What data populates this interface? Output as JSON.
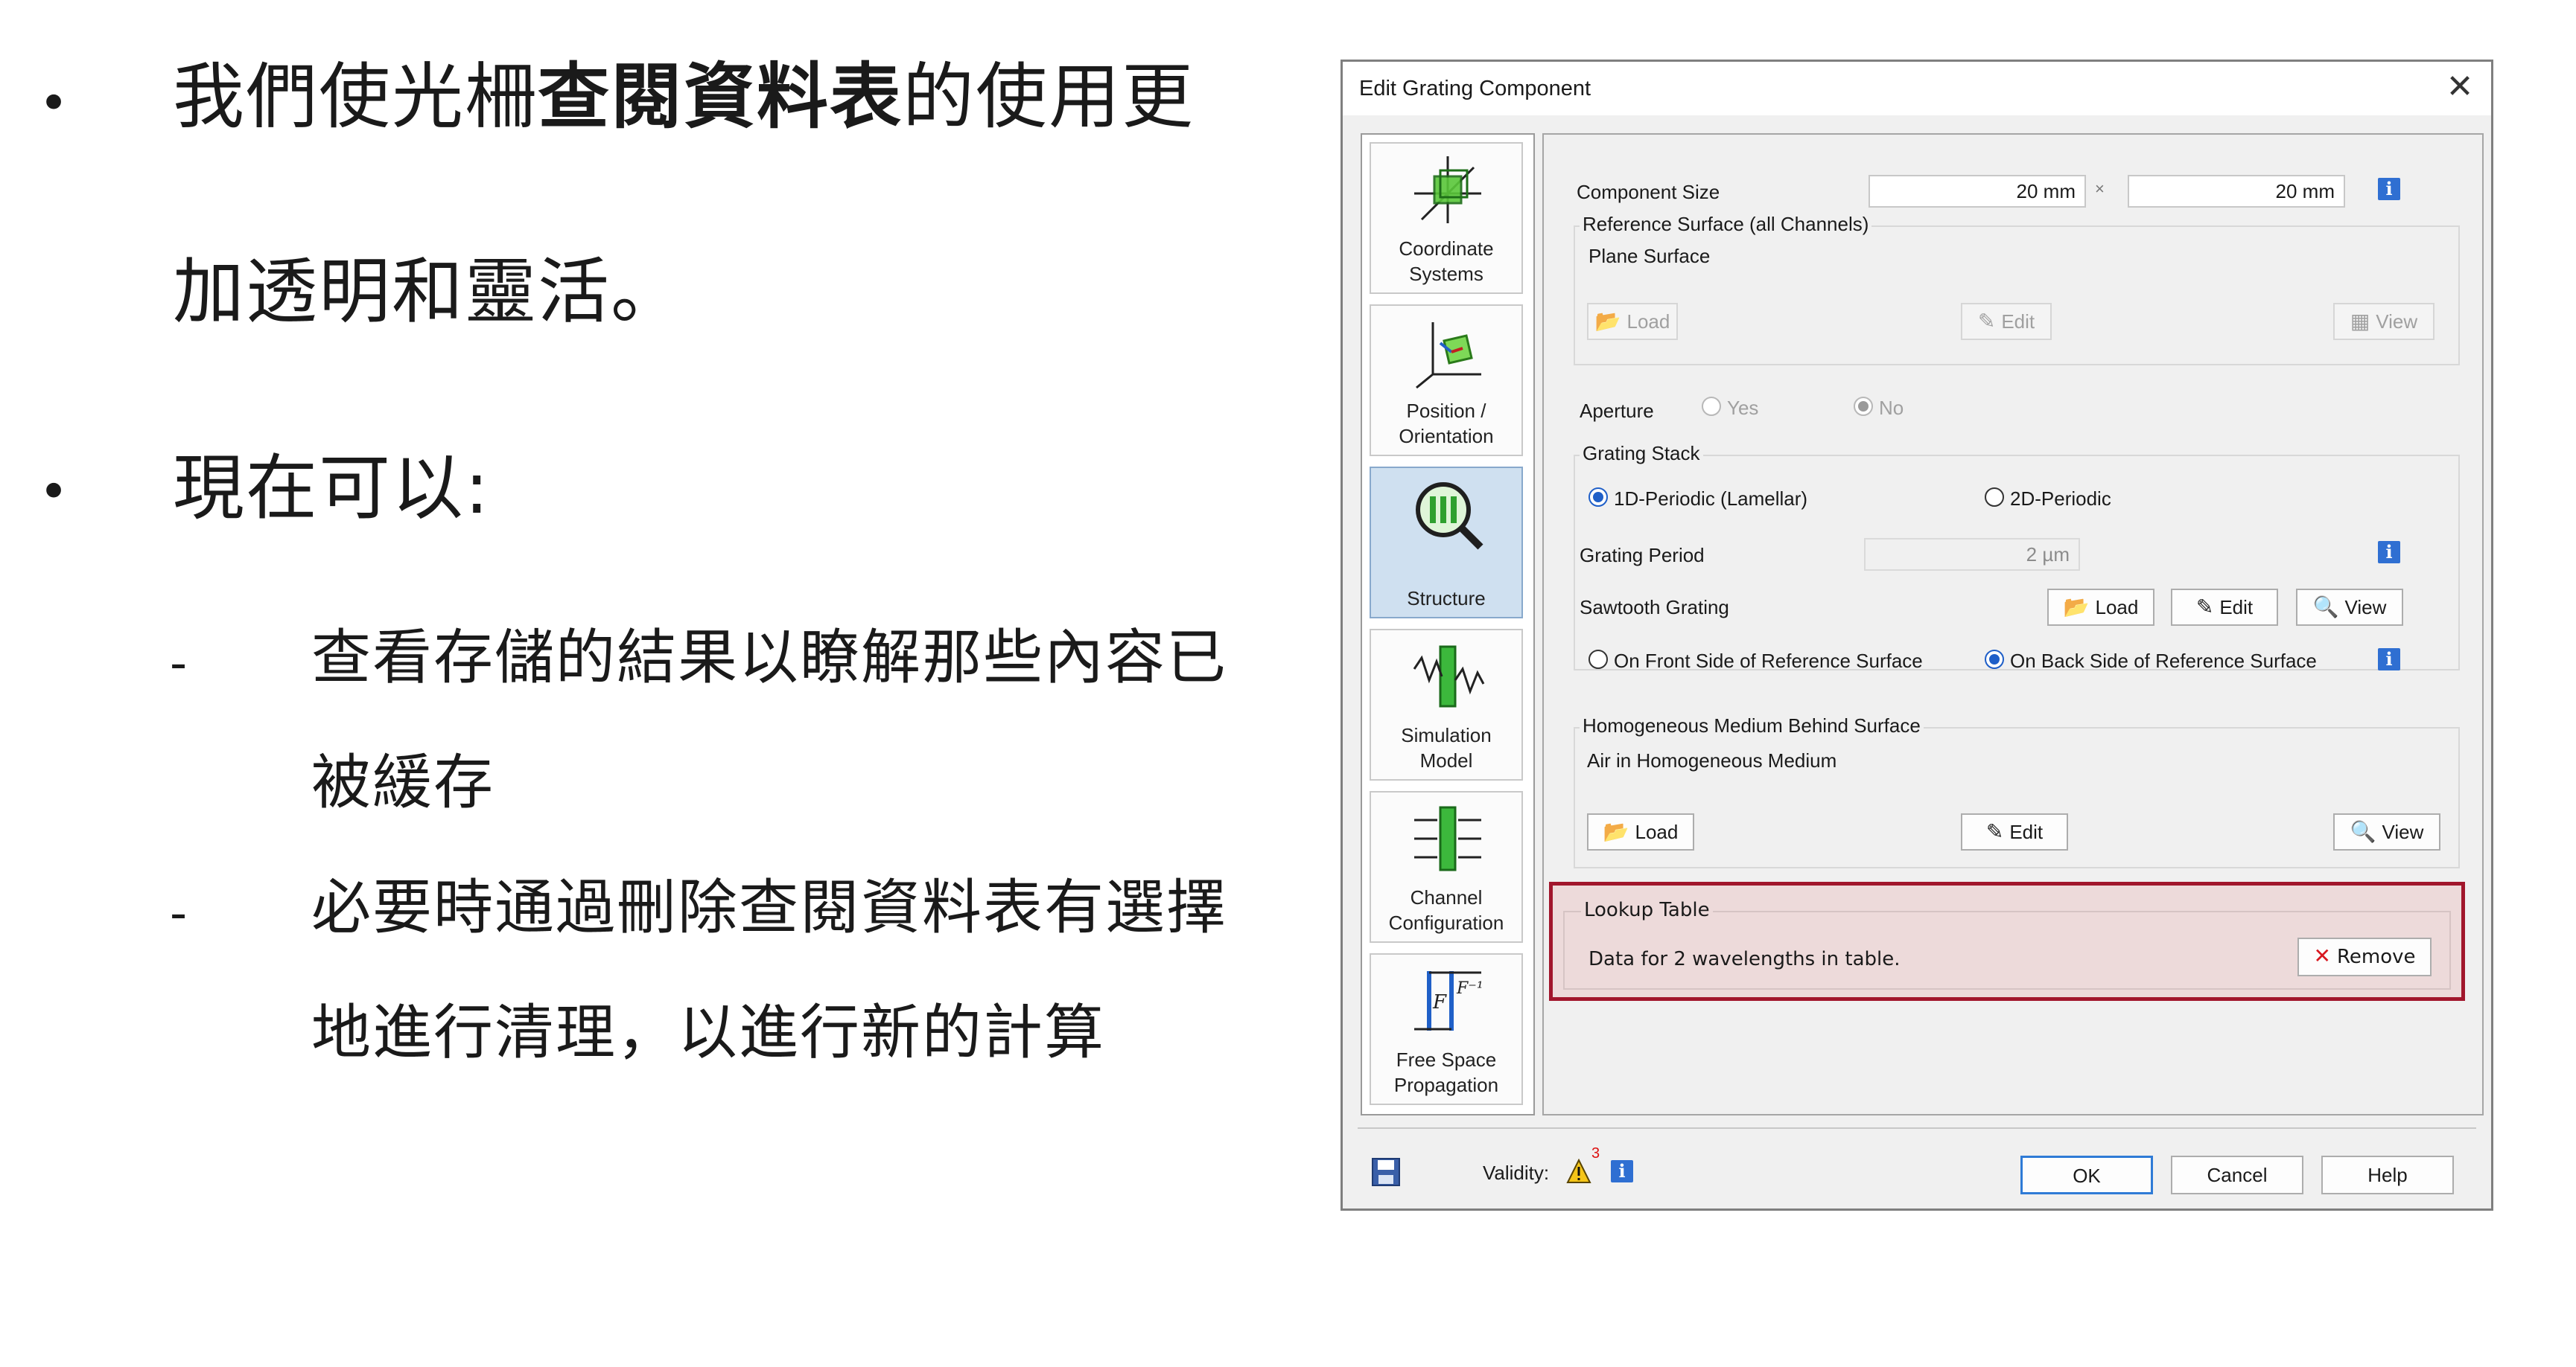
{
  "slide": {
    "bullet1_part1": "我們使光柵",
    "bullet1_bold": "查閱資料表",
    "bullet1_part2": "的使用更",
    "bullet1_line2": "加透明和靈活。",
    "bullet2": "現在可以:",
    "sub1_line1": "查看存儲的結果以瞭解那些內容已",
    "sub1_line2": "被緩存",
    "sub2_line1": "必要時通過刪除查閱資料表有選擇",
    "sub2_line2": "地進行清理，以進行新的計算",
    "bullet_char": "•",
    "dash_char": "-"
  },
  "dialog": {
    "title": "Edit Grating Component",
    "close_glyph": "✕",
    "nav": [
      {
        "label": "Coordinate\nSystems",
        "icon": "coordinate-systems-icon"
      },
      {
        "label": "Position /\nOrientation",
        "icon": "position-orientation-icon"
      },
      {
        "label": "Structure",
        "icon": "structure-icon"
      },
      {
        "label": "Simulation\nModel",
        "icon": "simulation-model-icon"
      },
      {
        "label": "Channel\nConfiguration",
        "icon": "channel-configuration-icon"
      },
      {
        "label": "Free Space\nPropagation",
        "icon": "free-space-propagation-icon"
      }
    ],
    "component_size": {
      "label": "Component Size",
      "width": "20 mm",
      "sep": "×",
      "height": "20 mm"
    },
    "reference_surface": {
      "title": "Reference Surface (all Channels)",
      "value": "Plane Surface",
      "load": "Load",
      "edit": "Edit",
      "view": "View"
    },
    "aperture": {
      "label": "Aperture",
      "yes": "Yes",
      "no": "No"
    },
    "grating_stack": {
      "title": "Grating Stack",
      "opt1": "1D-Periodic (Lamellar)",
      "opt2": "2D-Periodic",
      "period_label": "Grating Period",
      "period_value": "2 µm",
      "sawtooth_label": "Sawtooth Grating",
      "load": "Load",
      "edit": "Edit",
      "view": "View",
      "front": "On Front Side of Reference Surface",
      "back": "On Back Side of Reference Surface"
    },
    "homogeneous_medium": {
      "title": "Homogeneous Medium Behind Surface",
      "value": "Air in Homogeneous Medium",
      "load": "Load",
      "edit": "Edit",
      "view": "View"
    },
    "lookup_table": {
      "title": "Lookup Table",
      "value": "Data for 2 wavelengths in table.",
      "remove": "Remove"
    },
    "footer": {
      "validity": "Validity:",
      "warning_count": "3",
      "ok": "OK",
      "cancel": "Cancel",
      "help": "Help"
    },
    "info_glyph": "i",
    "colors": {
      "accent": "#2f6fd2",
      "highlight": "#a1162c",
      "active_nav": "#cfe0f0"
    }
  }
}
